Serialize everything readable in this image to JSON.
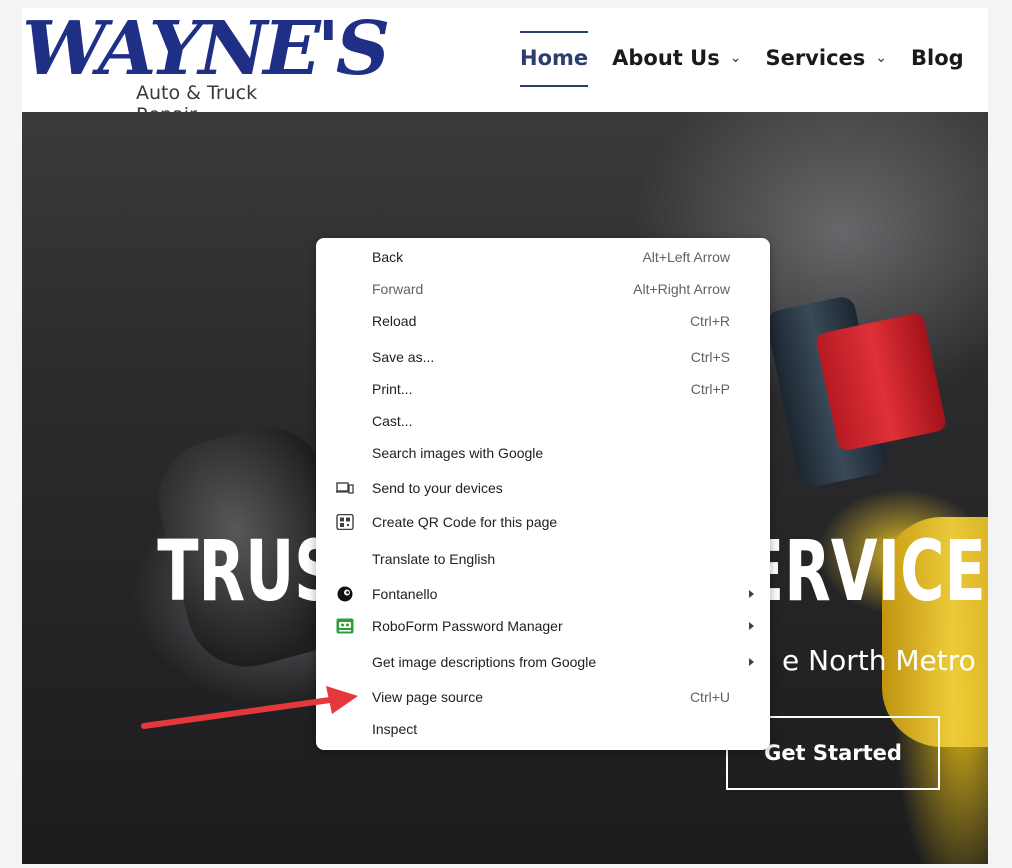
{
  "logo": {
    "main": "WAYNE'S",
    "sub": "Auto & Truck Repair"
  },
  "nav": {
    "items": [
      {
        "label": "Home",
        "active": true,
        "has_dropdown": false
      },
      {
        "label": "About Us",
        "active": false,
        "has_dropdown": true
      },
      {
        "label": "Services",
        "active": false,
        "has_dropdown": true
      },
      {
        "label": "Blog",
        "active": false,
        "has_dropdown": false
      }
    ]
  },
  "hero": {
    "title": "TRUSTED AUTO SERVICE",
    "subtitle": "e North Metro",
    "button": "Get Started"
  },
  "context_menu": {
    "items": [
      {
        "label": "Back",
        "shortcut": "Alt+Left Arrow",
        "disabled": false,
        "icon": null,
        "submenu": false
      },
      {
        "label": "Forward",
        "shortcut": "Alt+Right Arrow",
        "disabled": true,
        "icon": null,
        "submenu": false
      },
      {
        "label": "Reload",
        "shortcut": "Ctrl+R",
        "disabled": false,
        "icon": null,
        "submenu": false
      },
      {
        "label": "Save as...",
        "shortcut": "Ctrl+S",
        "disabled": false,
        "icon": null,
        "submenu": false
      },
      {
        "label": "Print...",
        "shortcut": "Ctrl+P",
        "disabled": false,
        "icon": null,
        "submenu": false
      },
      {
        "label": "Cast...",
        "shortcut": "",
        "disabled": false,
        "icon": null,
        "submenu": false
      },
      {
        "label": "Search images with Google",
        "shortcut": "",
        "disabled": false,
        "icon": null,
        "submenu": false
      },
      {
        "label": "Send to your devices",
        "shortcut": "",
        "disabled": false,
        "icon": "devices-icon",
        "submenu": false
      },
      {
        "label": "Create QR Code for this page",
        "shortcut": "",
        "disabled": false,
        "icon": "qr-code-icon",
        "submenu": false
      },
      {
        "label": "Translate to English",
        "shortcut": "",
        "disabled": false,
        "icon": null,
        "submenu": false
      },
      {
        "label": "Fontanello",
        "shortcut": "",
        "disabled": false,
        "icon": "fontanello-icon",
        "submenu": true
      },
      {
        "label": "RoboForm Password Manager",
        "shortcut": "",
        "disabled": false,
        "icon": "roboform-icon",
        "submenu": true
      },
      {
        "label": "Get image descriptions from Google",
        "shortcut": "",
        "disabled": false,
        "icon": null,
        "submenu": true
      },
      {
        "label": "View page source",
        "shortcut": "Ctrl+U",
        "disabled": false,
        "icon": null,
        "submenu": false
      },
      {
        "label": "Inspect",
        "shortcut": "",
        "disabled": false,
        "icon": null,
        "submenu": false
      }
    ]
  },
  "colors": {
    "brand": "#1f2f86",
    "nav_active": "#2c3e6b",
    "annotation_arrow": "#e5383b",
    "menu_shortcut": "#5f6368"
  }
}
